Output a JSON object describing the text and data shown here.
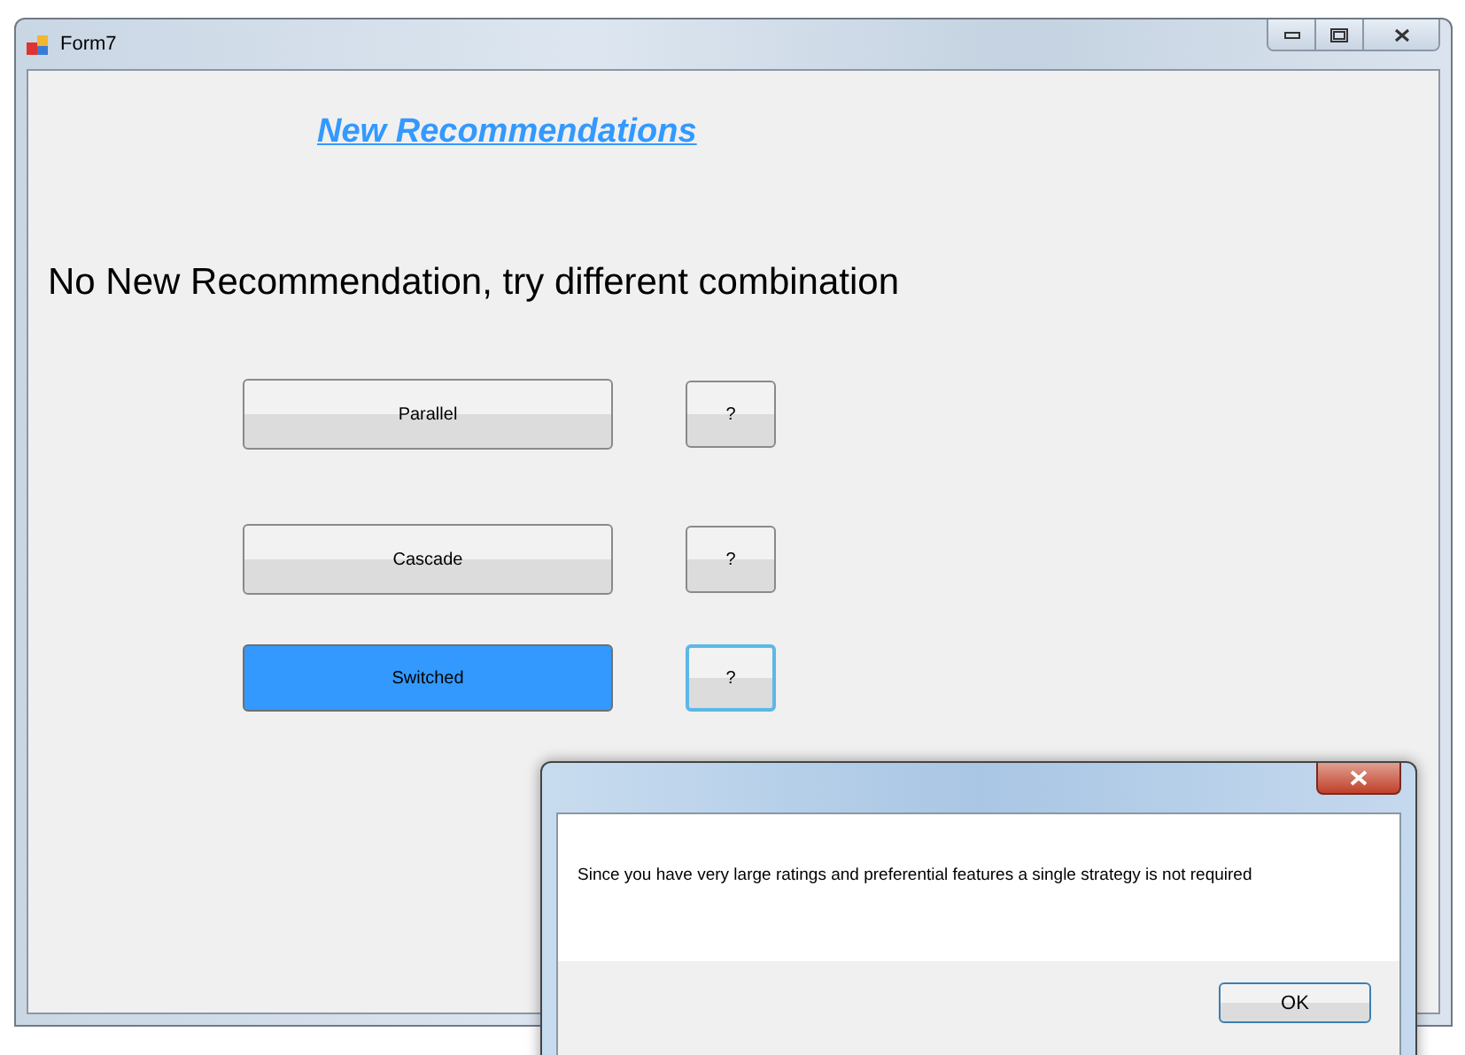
{
  "window": {
    "title": "Form7"
  },
  "heading": "New Recommendations",
  "message": "No New Recommendation, try different combination",
  "options": [
    {
      "label": "Parallel",
      "selected": false,
      "help": {
        "label": "?",
        "focused": false
      }
    },
    {
      "label": "Cascade",
      "selected": false,
      "help": {
        "label": "?",
        "focused": false
      }
    },
    {
      "label": "Switched",
      "selected": true,
      "help": {
        "label": "?",
        "focused": true
      }
    }
  ],
  "dialog": {
    "message": "Since you have very large ratings and preferential features a single strategy is not required",
    "button": "OK"
  }
}
